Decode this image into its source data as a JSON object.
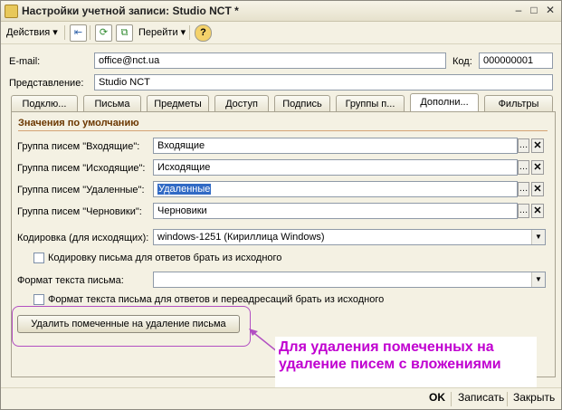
{
  "window": {
    "title": "Настройки учетной записи: Studio NCT *",
    "minimize": "–",
    "maximize": "□",
    "close": "✕"
  },
  "toolbar": {
    "actions": "Действия",
    "goto": "Перейти",
    "help": "?"
  },
  "header": {
    "email_label": "E-mail:",
    "email_value": "office@nct.ua",
    "code_label": "Код:",
    "code_value": "000000001",
    "display_label": "Представление:",
    "display_value": "Studio NCT"
  },
  "tabs": [
    "Подклю...",
    "Письма",
    "Предметы",
    "Доступ",
    "Подпись",
    "Группы п...",
    "Дополни...",
    "Фильтры"
  ],
  "active_tab": "Дополни...",
  "section": {
    "title": "Значения по умолчанию"
  },
  "groups": [
    {
      "label": "Группа писем \"Входящие\":",
      "value": "Входящие"
    },
    {
      "label": "Группа писем \"Исходящие\":",
      "value": "Исходящие"
    },
    {
      "label": "Группа писем \"Удаленные\":",
      "value": "Удаленные"
    },
    {
      "label": "Группа писем \"Черновики\":",
      "value": "Черновики"
    }
  ],
  "encoding": {
    "label": "Кодировка (для исходящих):",
    "value": "windows-1251 (Кириллица Windows)"
  },
  "encoding_reply_checkbox": {
    "label": "Кодировку письма для ответов брать из исходного",
    "checked": false
  },
  "format": {
    "label": "Формат текста письма:",
    "value": ""
  },
  "format_reply_checkbox": {
    "label": "Формат текста письма для ответов и переадресаций брать из исходного",
    "checked": false
  },
  "delete_button": "Удалить помеченные на удаление письма",
  "callout": {
    "line1": "Для удаления помеченных на",
    "line2": "удаление писем с вложениями"
  },
  "footer": {
    "ok": "OK",
    "save": "Записать",
    "close": "Закрыть"
  },
  "colors": {
    "accent": "#316ac5",
    "callout_text": "#c000d0",
    "highlight_border": "#b24fc2",
    "section_title": "#6b3700"
  }
}
